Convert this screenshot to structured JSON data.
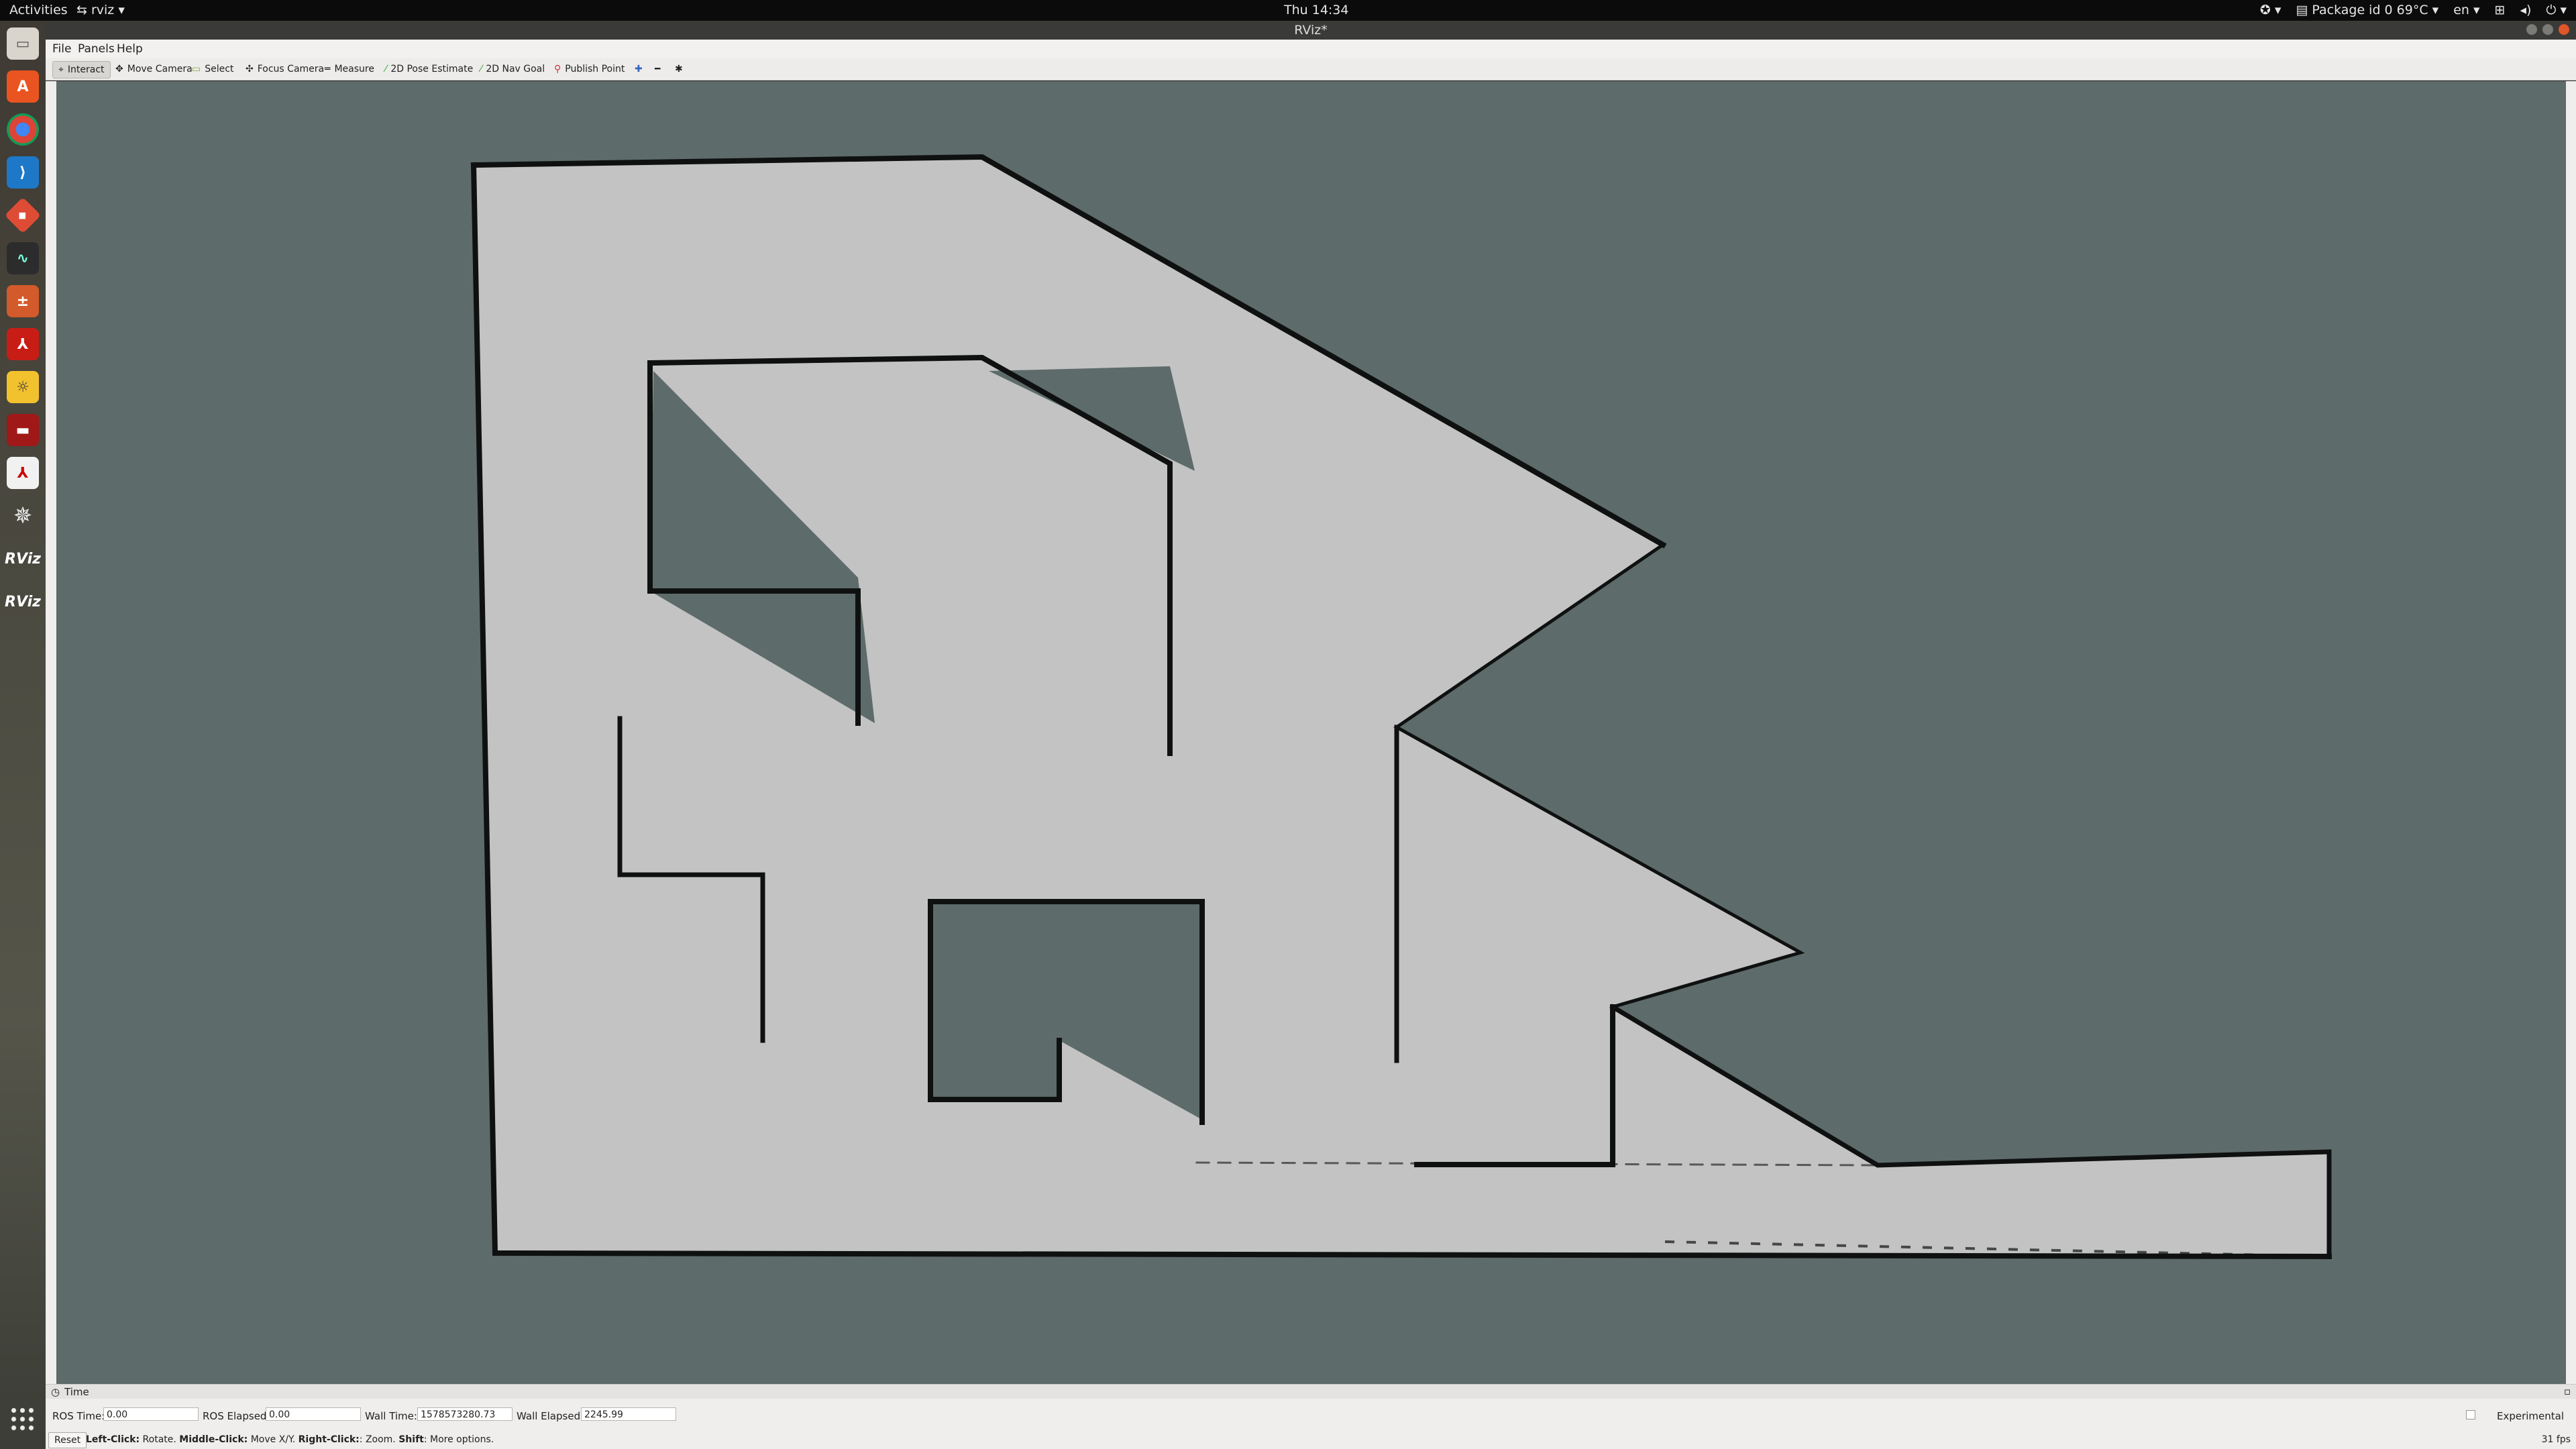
{
  "topbar": {
    "activities": "Activities",
    "app_menu": "rviz",
    "clock": "Thu 14:34",
    "package_temp": "Package id 0 69°C",
    "language": "en"
  },
  "window": {
    "title": "RViz*"
  },
  "dock": {
    "items": [
      {
        "icon": "files-icon"
      },
      {
        "icon": "software-center-icon"
      },
      {
        "icon": "chrome-icon"
      },
      {
        "icon": "vscode-icon"
      },
      {
        "icon": "git-icon"
      },
      {
        "icon": "system-monitor-icon"
      },
      {
        "icon": "calculator-icon"
      },
      {
        "icon": "acrobat-icon"
      },
      {
        "icon": "bulb-icon"
      },
      {
        "icon": "screen-recorder-icon"
      },
      {
        "icon": "pdf-icon"
      },
      {
        "icon": "ros-icon"
      },
      {
        "icon": "rviz-icon",
        "label": "RViz"
      },
      {
        "icon": "rviz-icon",
        "label": "RViz"
      }
    ]
  },
  "menubar": {
    "file": "File",
    "panels": "Panels",
    "help": "Help"
  },
  "toolbar": {
    "interact": "Interact",
    "move_camera": "Move Camera",
    "select": "Select",
    "focus_camera": "Focus Camera",
    "measure": "Measure",
    "pose_estimate": "2D Pose Estimate",
    "nav_goal": "2D Nav Goal",
    "publish_point": "Publish Point"
  },
  "time_panel": {
    "header": "Time",
    "ros_time_label": "ROS Time:",
    "ros_time_value": "0.00",
    "ros_elapsed_label": "ROS Elapsed:",
    "ros_elapsed_value": "0.00",
    "wall_time_label": "Wall Time:",
    "wall_time_value": "1578573280.73",
    "wall_elapsed_label": "Wall Elapsed:",
    "wall_elapsed_value": "2245.99",
    "experimental_label": "Experimental"
  },
  "status": {
    "reset": "Reset",
    "left_click": "Left-Click:",
    "left_action": " Rotate. ",
    "middle_click": "Middle-Click:",
    "middle_action": " Move X/Y. ",
    "right_click": "Right-Click:",
    "right_action": ": Zoom. ",
    "shift": "Shift",
    "shift_action": ": More options.",
    "fps": "31 fps"
  },
  "colors": {
    "map_free": "#c3c3c3",
    "map_unknown": "#5d6b6a",
    "map_wall": "#0f1111"
  }
}
